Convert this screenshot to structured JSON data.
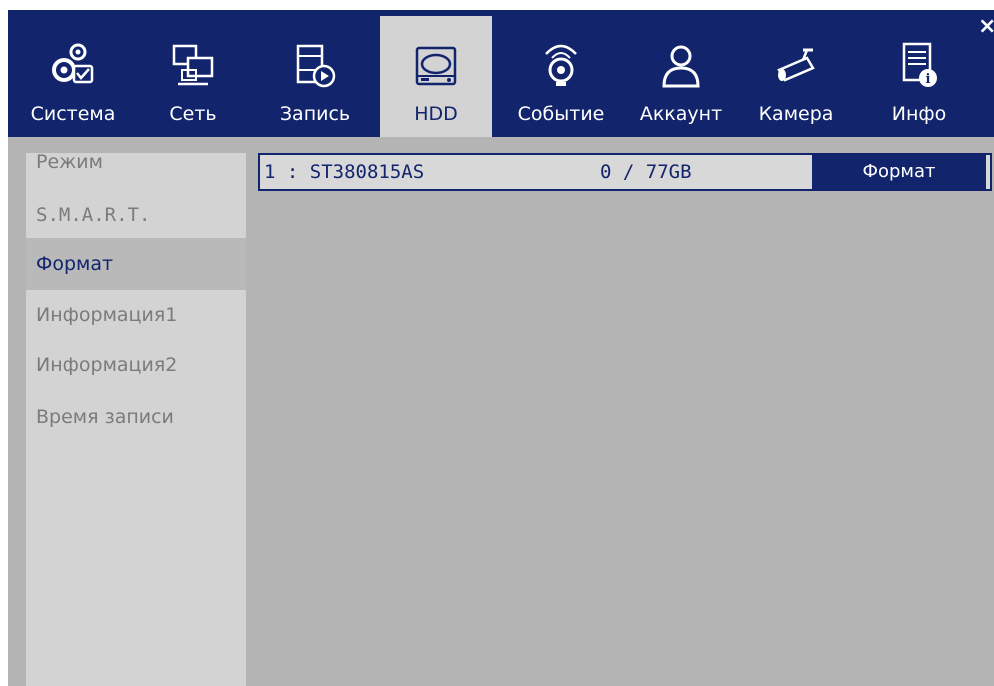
{
  "window": {
    "close_symbol": "×"
  },
  "tabs": [
    {
      "label": "Система",
      "icon": "gear-check-icon"
    },
    {
      "label": "Сеть",
      "icon": "network-icon"
    },
    {
      "label": "Запись",
      "icon": "record-icon"
    },
    {
      "label": "HDD",
      "icon": "hdd-icon",
      "active": true
    },
    {
      "label": "Событие",
      "icon": "event-icon"
    },
    {
      "label": "Аккаунт",
      "icon": "account-icon"
    },
    {
      "label": "Камера",
      "icon": "camera-icon"
    },
    {
      "label": "Инфо",
      "icon": "info-icon"
    }
  ],
  "sidebar": {
    "items": [
      {
        "label": "Режим"
      },
      {
        "label": "S.M.A.R.T."
      },
      {
        "label": "Формат",
        "active": true
      },
      {
        "label": "Информация1"
      },
      {
        "label": "Информация2"
      },
      {
        "label": "Время записи"
      }
    ]
  },
  "hdd_list": {
    "row": {
      "id": "1 : ST380815AS",
      "usage": "0 / 77GB",
      "format_label": "Формат"
    }
  },
  "colors": {
    "accent": "#12256c",
    "panel": "#d3d3d3",
    "background": "#b4b4b4"
  }
}
